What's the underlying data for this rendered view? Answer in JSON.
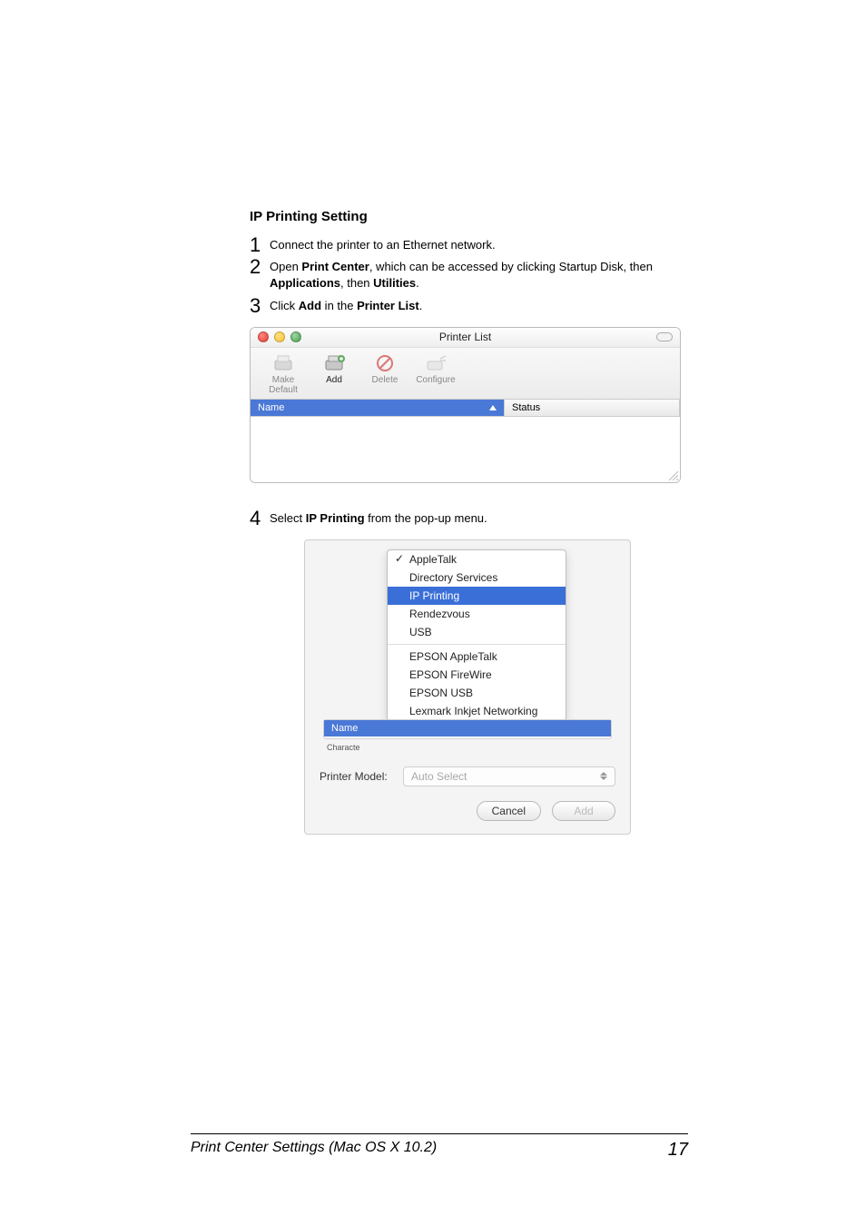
{
  "section_title": "IP Printing Setting",
  "steps": {
    "s1": {
      "n": "1",
      "pre": "Connect the printer to an Ethernet network."
    },
    "s2": {
      "n": "2",
      "a": "Open ",
      "b": "Print Center",
      "c": ", which can be accessed by clicking Startup Disk, then ",
      "d": "Applications",
      "e": ", then ",
      "f": "Utilities",
      "g": "."
    },
    "s3": {
      "n": "3",
      "a": "Click ",
      "b": "Add",
      "c": " in the ",
      "d": "Printer List",
      "e": "."
    },
    "s4": {
      "n": "4",
      "a": "Select ",
      "b": "IP Printing",
      "c": " from the pop-up menu."
    }
  },
  "win1": {
    "title": "Printer List",
    "tb": {
      "make_default": "Make Default",
      "add": "Add",
      "delete": "Delete",
      "configure": "Configure"
    },
    "cols": {
      "name": "Name",
      "status": "Status"
    }
  },
  "win2": {
    "popup": {
      "appletalk": "AppleTalk",
      "directory": "Directory Services",
      "ip": "IP Printing",
      "rendezvous": "Rendezvous",
      "usb": "USB",
      "ep_at": "EPSON AppleTalk",
      "ep_fw": "EPSON FireWire",
      "ep_usb": "EPSON USB",
      "lexmark": "Lexmark Inkjet Networking"
    },
    "name_col": "Name",
    "character": "Characte",
    "model_label": "Printer Model:",
    "model_value": "Auto Select",
    "cancel": "Cancel",
    "add": "Add"
  },
  "footer": {
    "title": "Print Center Settings (Mac OS X 10.2)",
    "page": "17"
  }
}
